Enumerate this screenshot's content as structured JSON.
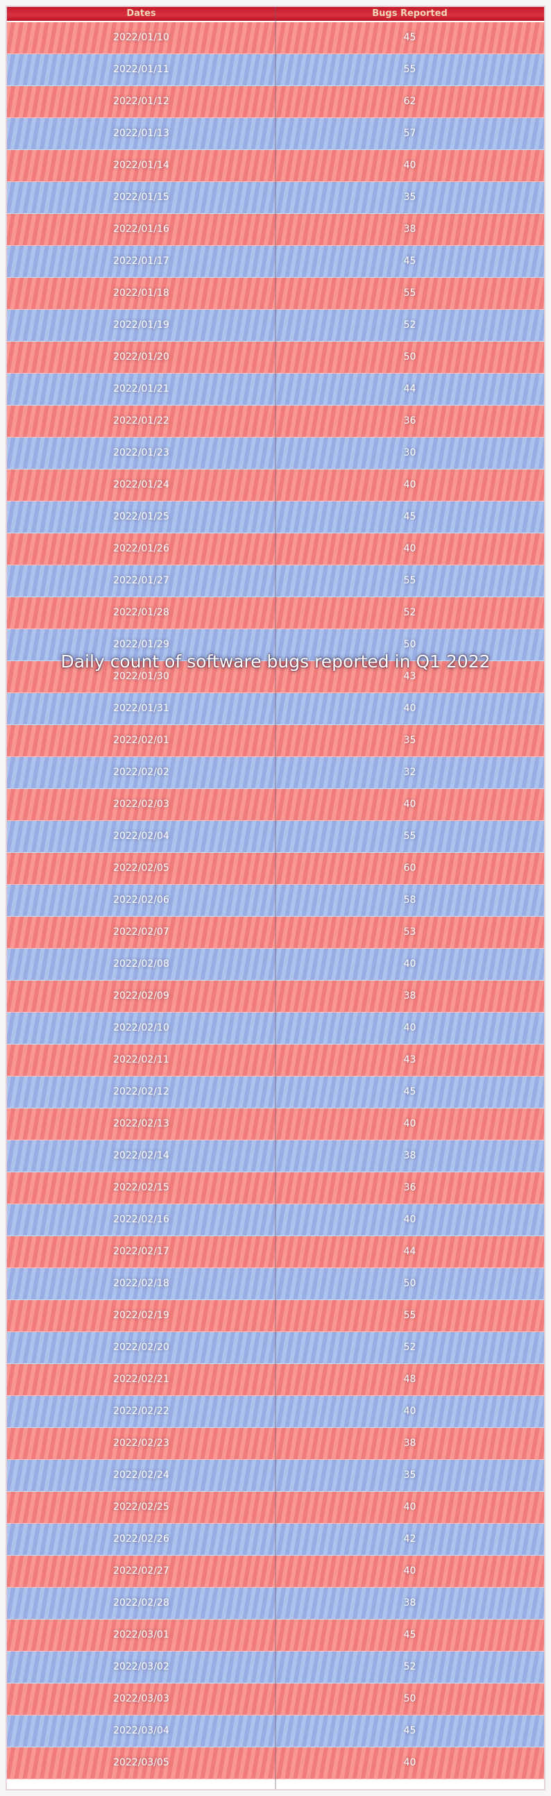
{
  "chart_data": {
    "type": "table",
    "title": "Daily count of software bugs reported in Q1 2022",
    "columns": [
      "Dates",
      "Bugs Reported"
    ],
    "x": [
      "2022/01/10",
      "2022/01/11",
      "2022/01/12",
      "2022/01/13",
      "2022/01/14",
      "2022/01/15",
      "2022/01/16",
      "2022/01/17",
      "2022/01/18",
      "2022/01/19",
      "2022/01/20",
      "2022/01/21",
      "2022/01/22",
      "2022/01/23",
      "2022/01/24",
      "2022/01/25",
      "2022/01/26",
      "2022/01/27",
      "2022/01/28",
      "2022/01/29",
      "2022/01/30",
      "2022/01/31",
      "2022/02/01",
      "2022/02/02",
      "2022/02/03",
      "2022/02/04",
      "2022/02/05",
      "2022/02/06",
      "2022/02/07",
      "2022/02/08",
      "2022/02/09",
      "2022/02/10",
      "2022/02/11",
      "2022/02/12",
      "2022/02/13",
      "2022/02/14",
      "2022/02/15",
      "2022/02/16",
      "2022/02/17",
      "2022/02/18",
      "2022/02/19",
      "2022/02/20",
      "2022/02/21",
      "2022/02/22",
      "2022/02/23",
      "2022/02/24",
      "2022/02/25",
      "2022/02/26",
      "2022/02/27",
      "2022/02/28",
      "2022/03/01",
      "2022/03/02",
      "2022/03/03",
      "2022/03/04",
      "2022/03/05"
    ],
    "values": [
      45,
      55,
      62,
      57,
      40,
      35,
      38,
      45,
      55,
      52,
      50,
      44,
      36,
      30,
      40,
      45,
      40,
      55,
      52,
      50,
      43,
      40,
      35,
      32,
      40,
      55,
      60,
      58,
      53,
      40,
      38,
      40,
      43,
      45,
      40,
      38,
      36,
      40,
      44,
      50,
      55,
      52,
      48,
      40,
      38,
      35,
      40,
      42,
      40,
      38,
      45,
      52,
      50,
      45,
      40
    ],
    "colors": {
      "header": "#c41a2c",
      "row_odd": "#f58b8b",
      "row_even": "#a9bde9"
    }
  }
}
